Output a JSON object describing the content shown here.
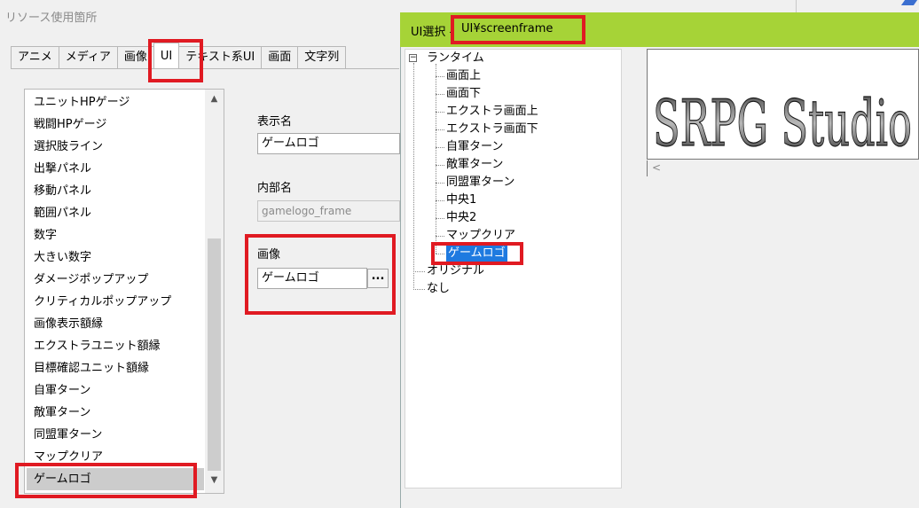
{
  "window": {
    "title": "リソース使用箇所"
  },
  "tabs": [
    {
      "label": "アニメ"
    },
    {
      "label": "メディア"
    },
    {
      "label": "画像"
    },
    {
      "label": "UI",
      "active": true
    },
    {
      "label": "テキスト系UI"
    },
    {
      "label": "画面"
    },
    {
      "label": "文字列"
    }
  ],
  "ui_list": {
    "items": [
      "ユニットHPゲージ",
      "戦闘HPゲージ",
      "選択肢ライン",
      "出撃パネル",
      "移動パネル",
      "範囲パネル",
      "数字",
      "大きい数字",
      "ダメージポップアップ",
      "クリティカルポップアップ",
      "画像表示額縁",
      "エクストラユニット額縁",
      "目標確認ユニット額縁",
      "自軍ターン",
      "敵軍ターン",
      "同盟軍ターン",
      "マップクリア",
      "ゲームロゴ"
    ],
    "selected": "ゲームロゴ"
  },
  "form": {
    "display_name_label": "表示名",
    "display_name_value": "ゲームロゴ",
    "internal_name_label": "内部名",
    "internal_name_value": "gamelogo_frame",
    "image_label": "画像",
    "image_value": "ゲームロゴ",
    "browse_label": "..."
  },
  "dialog": {
    "title": "UI選択",
    "title_separator": "-",
    "title_path": "UI¥screenframe",
    "titlebar_color": "#a6d337",
    "tree": {
      "root": "ランタイム",
      "root_toggle": "−",
      "children": [
        "画面上",
        "画面下",
        "エクストラ画面上",
        "エクストラ画面下",
        "自軍ターン",
        "敵軍ターン",
        "同盟軍ターン",
        "中央1",
        "中央2",
        "マップクリア",
        "ゲームロゴ"
      ],
      "selected": "ゲームロゴ",
      "siblings": [
        "オリジナル",
        "なし"
      ]
    },
    "preview": {
      "logo_text": "SRPG Studio",
      "scroll_left": "<"
    }
  },
  "colors": {
    "highlight": "#e01a22",
    "selection": "#1e7ae0"
  }
}
